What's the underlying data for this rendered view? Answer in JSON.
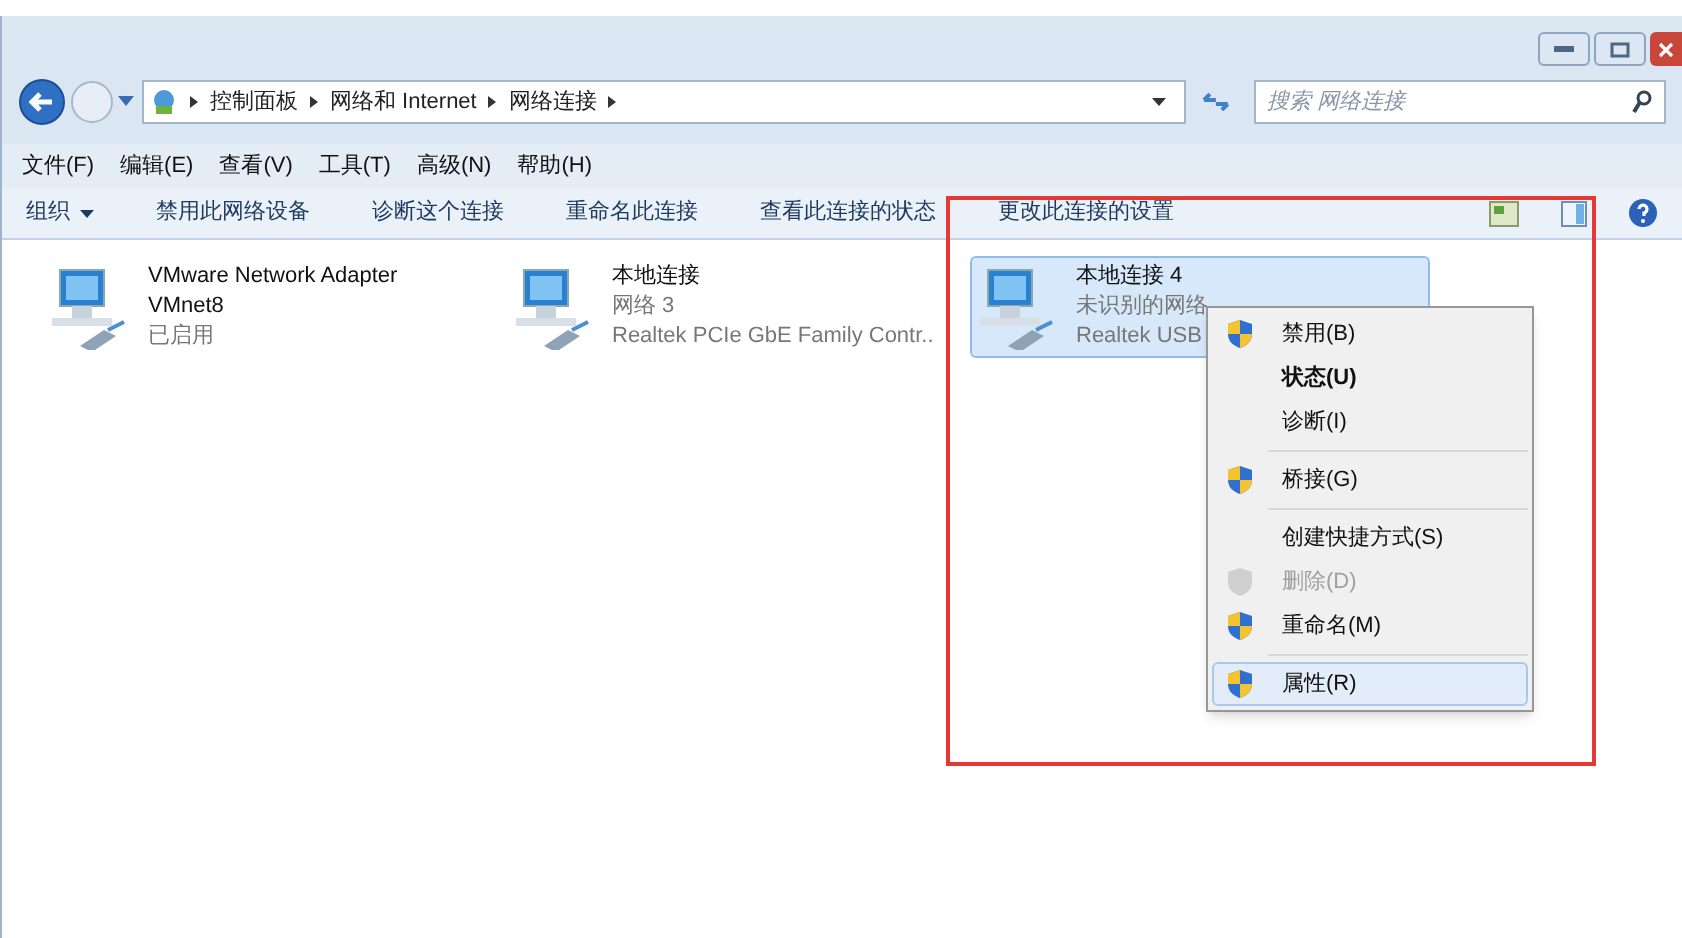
{
  "window": {
    "controls": [
      {
        "kind": "minimize"
      },
      {
        "kind": "maximize"
      },
      {
        "kind": "close"
      }
    ]
  },
  "address_bar": {
    "path": [
      "控制面板",
      "网络和 Internet",
      "网络连接"
    ],
    "search_placeholder": "搜索 网络连接"
  },
  "menu_bar": [
    "文件(F)",
    "编辑(E)",
    "查看(V)",
    "工具(T)",
    "高级(N)",
    "帮助(H)"
  ],
  "toolbar": [
    {
      "label": "组织",
      "dropdown": true
    },
    {
      "label": "禁用此网络设备",
      "dropdown": false
    },
    {
      "label": "诊断这个连接",
      "dropdown": false
    },
    {
      "label": "重命名此连接",
      "dropdown": false
    },
    {
      "label": "查看此连接的状态",
      "dropdown": false
    },
    {
      "label": "更改此连接的设置",
      "dropdown": false
    }
  ],
  "connections": [
    {
      "name": "VMware Network Adapter VMnet8",
      "status": "已启用",
      "selected": false
    },
    {
      "name": "本地连接",
      "status": "网络 3",
      "device": "Realtek PCIe GbE Family Contr..",
      "selected": false
    },
    {
      "name": "本地连接 4",
      "status": "未识别的网络",
      "device": "Realtek USB",
      "selected": true
    }
  ],
  "context_menu": [
    {
      "kind": "item",
      "label": "禁用(B)",
      "shield": true,
      "bold": false,
      "disabled": false,
      "selected": false
    },
    {
      "kind": "item",
      "label": "状态(U)",
      "shield": false,
      "bold": true,
      "disabled": false,
      "selected": false
    },
    {
      "kind": "item",
      "label": "诊断(I)",
      "shield": false,
      "bold": false,
      "disabled": false,
      "selected": false
    },
    {
      "kind": "separator"
    },
    {
      "kind": "item",
      "label": "桥接(G)",
      "shield": true,
      "bold": false,
      "disabled": false,
      "selected": false
    },
    {
      "kind": "separator"
    },
    {
      "kind": "item",
      "label": "创建快捷方式(S)",
      "shield": false,
      "bold": false,
      "disabled": false,
      "selected": false
    },
    {
      "kind": "item",
      "label": "删除(D)",
      "shield": true,
      "bold": false,
      "disabled": true,
      "selected": false
    },
    {
      "kind": "item",
      "label": "重命名(M)",
      "shield": true,
      "bold": false,
      "disabled": false,
      "selected": false
    },
    {
      "kind": "separator"
    },
    {
      "kind": "item",
      "label": "属性(R)",
      "shield": true,
      "bold": false,
      "disabled": false,
      "selected": true
    }
  ],
  "annotation_frame": true
}
